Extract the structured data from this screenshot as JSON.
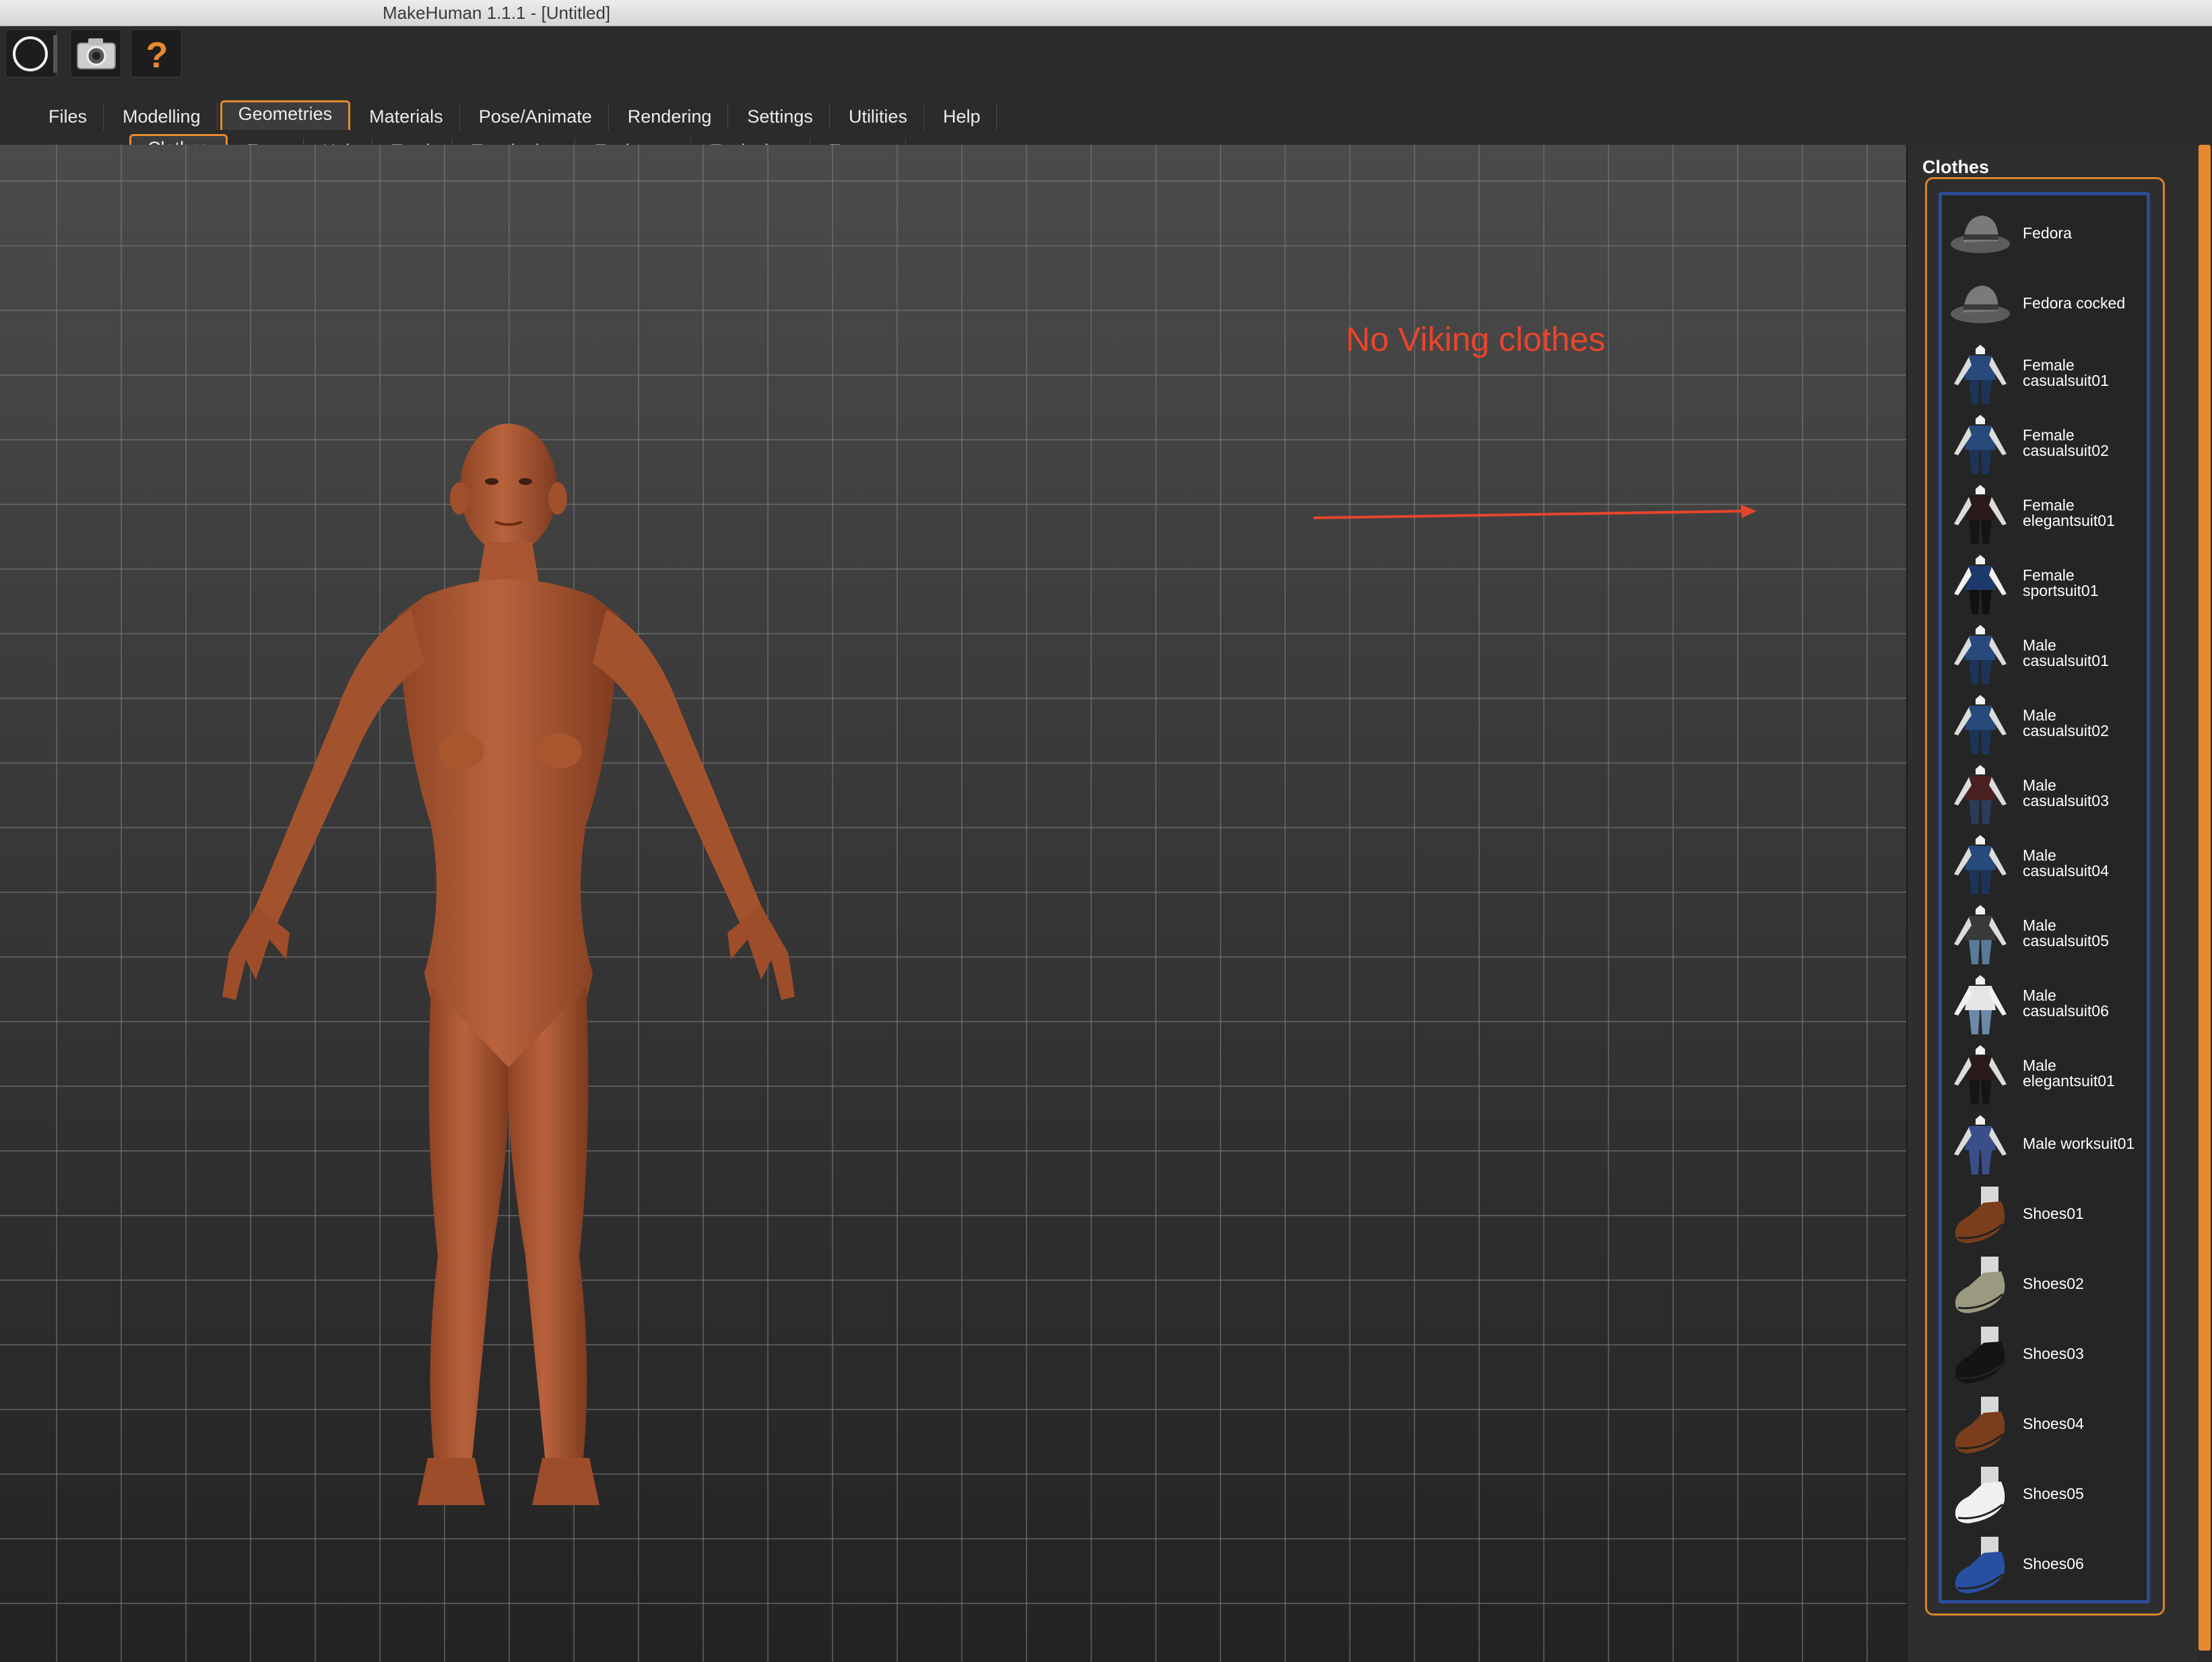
{
  "window": {
    "title": "MakeHuman 1.1.1 - [Untitled]"
  },
  "toolbar": {
    "buttons": [
      {
        "name": "wireframe-icon"
      },
      {
        "name": "camera-icon"
      },
      {
        "name": "help-question-icon",
        "glyph": "?"
      }
    ]
  },
  "main_tabs": {
    "active": "Geometries",
    "items": [
      "Files",
      "Modelling",
      "Geometries",
      "Materials",
      "Pose/Animate",
      "Rendering",
      "Settings",
      "Utilities",
      "Help"
    ]
  },
  "sub_tabs": {
    "active": "Clothes",
    "items": [
      "Clothes",
      "Eyes",
      "Hair",
      "Teeth",
      "Topologies",
      "Eyebrows",
      "Eyelashes",
      "Tongue"
    ]
  },
  "viewport": {
    "annotation_text": "No Viking clothes",
    "annotation_color": "#e8452c"
  },
  "panel": {
    "title": "Clothes",
    "accent_color": "#e68a2e",
    "list_border_color": "#2b4c97",
    "items": [
      {
        "label": "Fedora",
        "thumb": "hat"
      },
      {
        "label": "Fedora cocked",
        "thumb": "hat"
      },
      {
        "label": "Female\ncasualsuit01",
        "thumb": "suit-blue"
      },
      {
        "label": "Female\ncasualsuit02",
        "thumb": "suit-blue"
      },
      {
        "label": "Female\nelegantsuit01",
        "thumb": "suit-dark"
      },
      {
        "label": "Female\nsportsuit01",
        "thumb": "suit-sport"
      },
      {
        "label": "Male\ncasualsuit01",
        "thumb": "suit-blue"
      },
      {
        "label": "Male\ncasualsuit02",
        "thumb": "suit-blue"
      },
      {
        "label": "Male\ncasualsuit03",
        "thumb": "suit-maroon"
      },
      {
        "label": "Male\ncasualsuit04",
        "thumb": "suit-blue"
      },
      {
        "label": "Male\ncasualsuit05",
        "thumb": "suit-grey"
      },
      {
        "label": "Male\ncasualsuit06",
        "thumb": "suit-white"
      },
      {
        "label": "Male\nelegantsuit01",
        "thumb": "suit-dark"
      },
      {
        "label": "Male worksuit01",
        "thumb": "suit-work"
      },
      {
        "label": "Shoes01",
        "thumb": "shoe-brown"
      },
      {
        "label": "Shoes02",
        "thumb": "shoe-sneaker"
      },
      {
        "label": "Shoes03",
        "thumb": "shoe-black"
      },
      {
        "label": "Shoes04",
        "thumb": "shoe-brown"
      },
      {
        "label": "Shoes05",
        "thumb": "shoe-white"
      },
      {
        "label": "Shoes06",
        "thumb": "shoe-blue"
      }
    ]
  }
}
